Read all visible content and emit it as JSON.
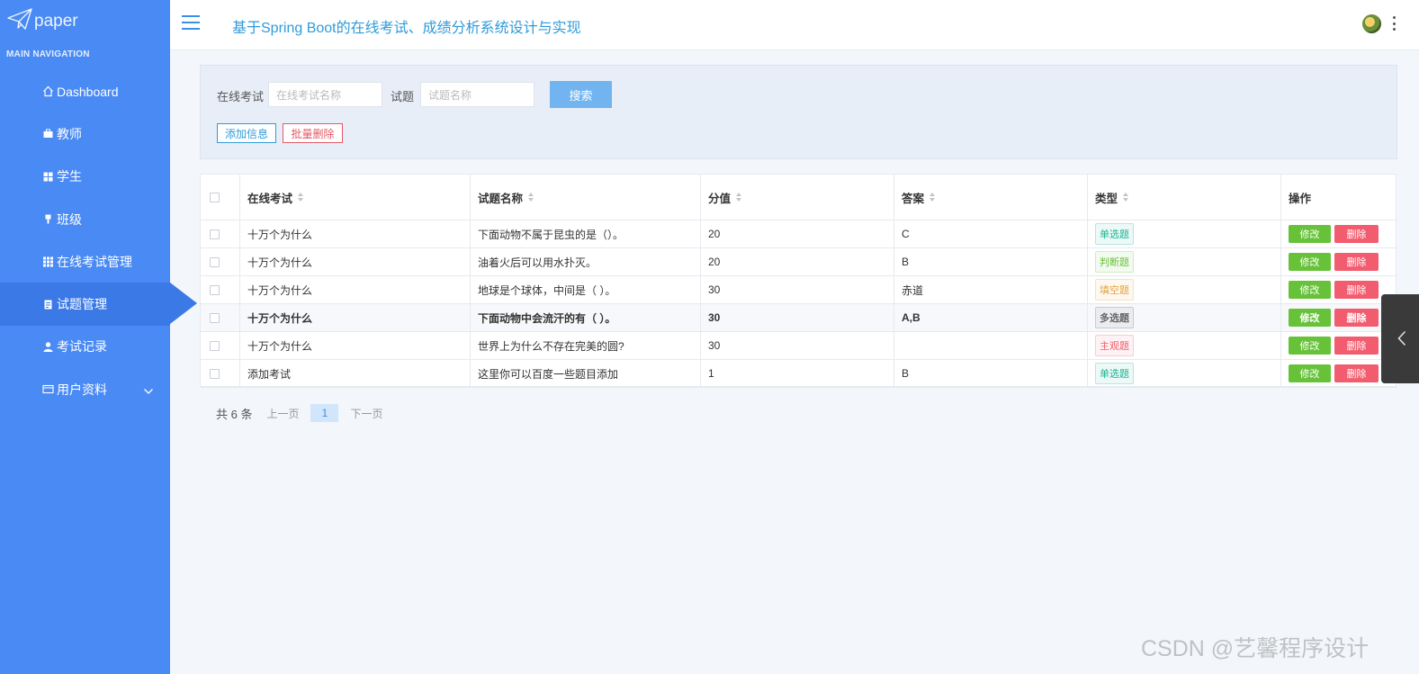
{
  "app": {
    "logo_text": "paper",
    "title": "基于Spring Boot的在线考试、成绩分析系统设计与实现"
  },
  "sidebar": {
    "header": "MAIN NAVIGATION",
    "items": [
      {
        "label": "Dashboard",
        "icon": "home-icon"
      },
      {
        "label": "教师",
        "icon": "briefcase-icon"
      },
      {
        "label": "学生",
        "icon": "grid-icon"
      },
      {
        "label": "班级",
        "icon": "pin-icon"
      },
      {
        "label": "在线考试管理",
        "icon": "apps-icon"
      },
      {
        "label": "试题管理",
        "icon": "document-icon",
        "active": true
      },
      {
        "label": "考试记录",
        "icon": "user-icon"
      },
      {
        "label": "用户资料",
        "icon": "card-icon",
        "has_submenu": true
      }
    ]
  },
  "search": {
    "exam_label": "在线考试",
    "exam_placeholder": "在线考试名称",
    "question_label": "试题",
    "question_placeholder": "试题名称",
    "search_button": "搜索",
    "add_button": "添加信息",
    "batch_delete_button": "批量删除"
  },
  "table": {
    "headers": [
      "在线考试",
      "试题名称",
      "分值",
      "答案",
      "类型",
      "操作"
    ],
    "rows": [
      {
        "exam": "十万个为什么",
        "question": "下面动物不属于昆虫的是（）。",
        "score": "20",
        "answer": "C",
        "type": "单选题",
        "type_color": "#1bb394"
      },
      {
        "exam": "十万个为什么",
        "question": "油着火后可以用水扑灭。",
        "score": "20",
        "answer": "B",
        "type": "判断题",
        "type_color": "#67c23a"
      },
      {
        "exam": "十万个为什么",
        "question": "地球是个球体，中间是（ ）。",
        "score": "30",
        "answer": "赤道",
        "type": "填空题",
        "type_color": "#e6a23c"
      },
      {
        "exam": "十万个为什么",
        "question": "下面动物中会流汗的有（ ）。",
        "score": "30",
        "answer": "A,B",
        "type": "多选题",
        "type_color": "#666666"
      },
      {
        "exam": "十万个为什么",
        "question": "世界上为什么不存在完美的圆?",
        "score": "30",
        "answer": "",
        "type": "主观题",
        "type_color": "#f15c6e"
      },
      {
        "exam": "添加考试",
        "question": "这里你可以百度一些题目添加",
        "score": "1",
        "answer": "B",
        "type": "单选题",
        "type_color": "#1bb394"
      }
    ],
    "edit_label": "修改",
    "delete_label": "删除"
  },
  "pagination": {
    "total": "共 6 条",
    "prev": "上一页",
    "current": "1",
    "next": "下一页"
  },
  "watermark": "CSDN @艺馨程序设计",
  "colors": {
    "sidebar": "#4a8af4",
    "accent": "#2f9bd8",
    "edit": "#67c23a",
    "delete": "#f15c6e"
  }
}
